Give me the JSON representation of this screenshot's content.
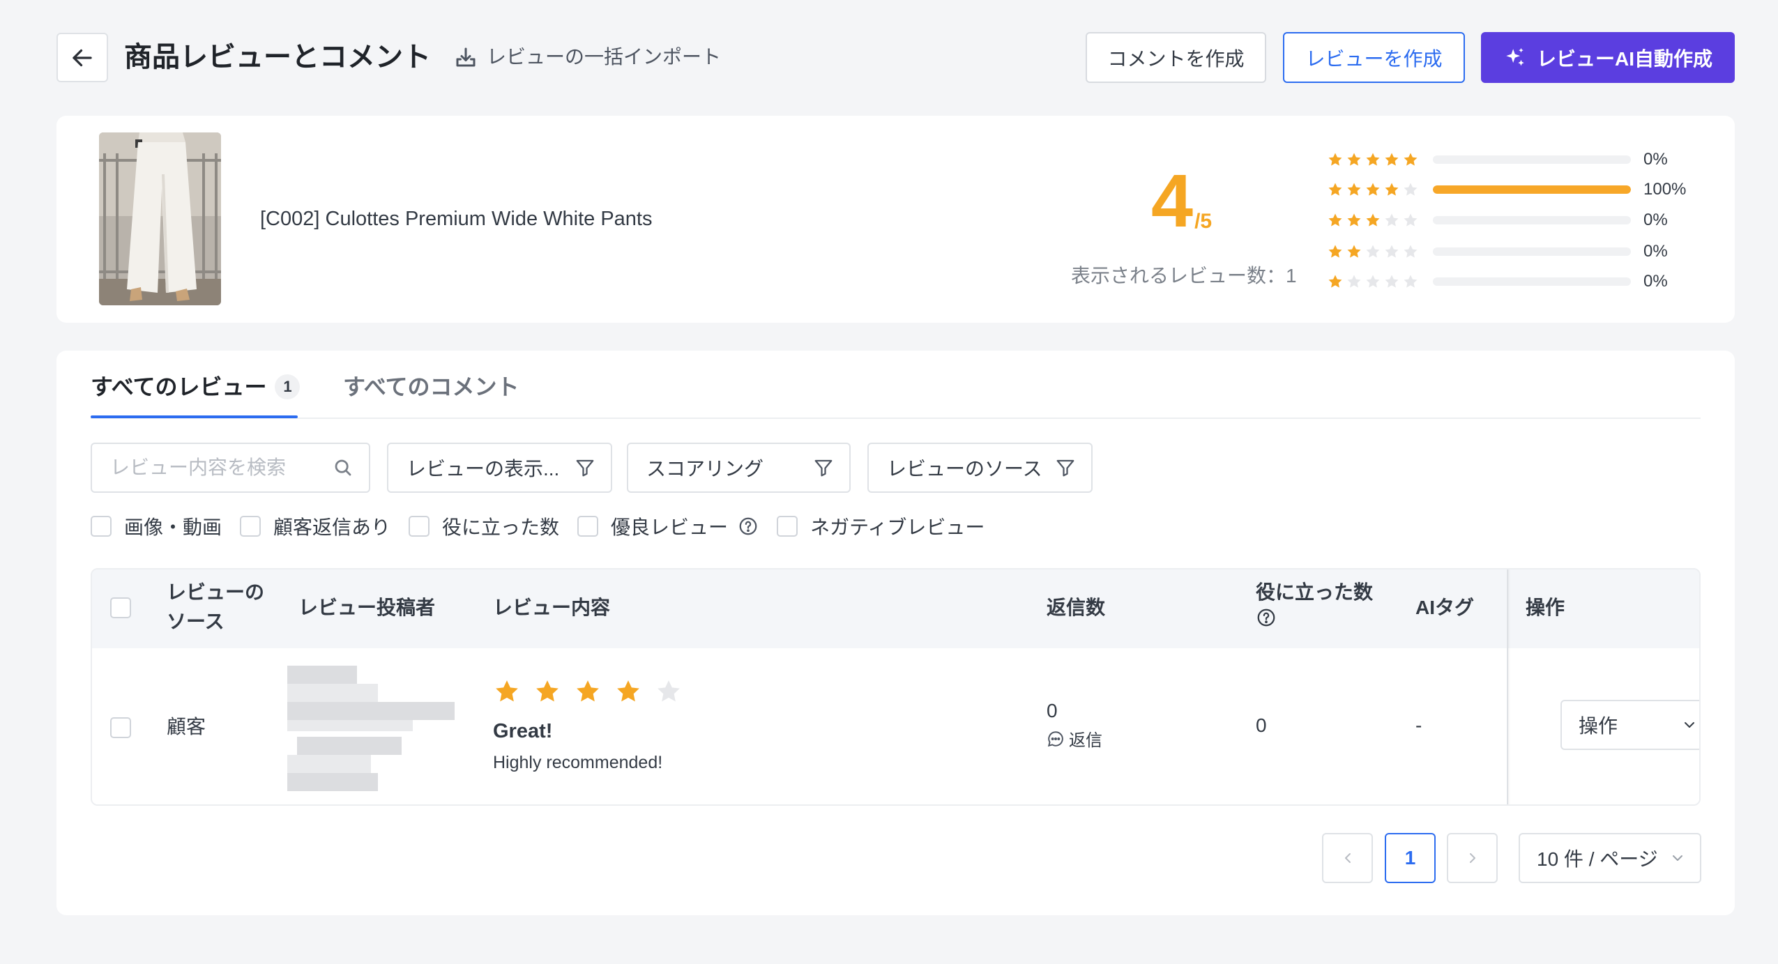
{
  "header": {
    "title": "商品レビューとコメント",
    "import_label": "レビューの一括インポート",
    "create_comment_label": "コメントを作成",
    "create_review_label": "レビューを作成",
    "ai_review_label": "レビューAI自動作成"
  },
  "product": {
    "name": "[C002] Culottes Premium Wide White Pants",
    "rating": "4",
    "rating_max": "/5",
    "rating_value": 4,
    "review_count_label": "表示されるレビュー数：1",
    "distribution": [
      {
        "stars": 5,
        "fraction": 0,
        "percent_label": "0%"
      },
      {
        "stars": 4,
        "fraction": 1,
        "percent_label": "100%"
      },
      {
        "stars": 3,
        "fraction": 0,
        "percent_label": "0%"
      },
      {
        "stars": 2,
        "fraction": 0,
        "percent_label": "0%"
      },
      {
        "stars": 1,
        "fraction": 0,
        "percent_label": "0%"
      }
    ]
  },
  "tabs": [
    {
      "label": "すべてのレビュー",
      "count": "1",
      "active": true
    },
    {
      "label": "すべてのコメント",
      "active": false
    }
  ],
  "filters": {
    "search_placeholder": "レビュー内容を検索",
    "display_filter": "レビューの表示...",
    "scoring_filter": "スコアリング",
    "source_filter": "レビューのソース"
  },
  "checkboxes": [
    {
      "label": "画像・動画"
    },
    {
      "label": "顧客返信あり"
    },
    {
      "label": "役に立った数"
    },
    {
      "label": "優良レビュー",
      "help": true
    },
    {
      "label": "ネガティブレビュー"
    }
  ],
  "table": {
    "headers": {
      "source_line1": "レビューの",
      "source_line2": "ソース",
      "author": "レビュー投稿者",
      "content": "レビュー内容",
      "replies": "返信数",
      "helpful": "役に立った数",
      "ai_tag": "AIタグ",
      "actions": "操作"
    },
    "rows": [
      {
        "source": "顧客",
        "rating": 4,
        "title": "Great!",
        "body": "Highly recommended!",
        "reply_count": "0",
        "reply_label": "返信",
        "helpful": "0",
        "ai_tag": "-",
        "action_label": "操作"
      }
    ]
  },
  "pagination": {
    "current_page": "1",
    "page_size_label": "10 件 / ページ"
  },
  "colors": {
    "accent": "#2c6cf0",
    "ai_button": "#5b3ee0",
    "star": "#f5a623",
    "star_empty": "#e6e7ea"
  },
  "icons": [
    "arrow-left-icon",
    "download-icon",
    "sparkle-icon",
    "search-icon",
    "filter-icon",
    "help-circle-icon",
    "chat-bubble-icon",
    "chevron-down-icon",
    "chevron-left-icon",
    "chevron-right-icon",
    "star-icon"
  ]
}
